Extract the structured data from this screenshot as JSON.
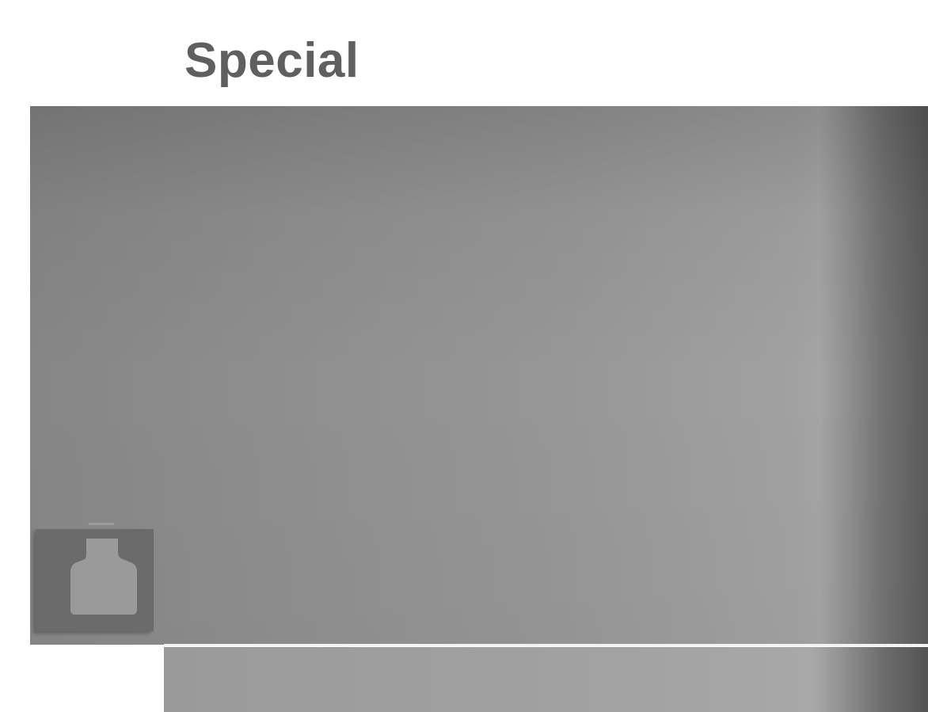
{
  "menu": {
    "title": "Special",
    "active_tab_icon": "special-bottle-icon",
    "colors": {
      "title_text": "#5f5f5f",
      "panel": "#929292",
      "icon_box": "#6b6b6b",
      "icon_glyph": "#9a9a9a",
      "divider": "#f2f2f2"
    }
  }
}
